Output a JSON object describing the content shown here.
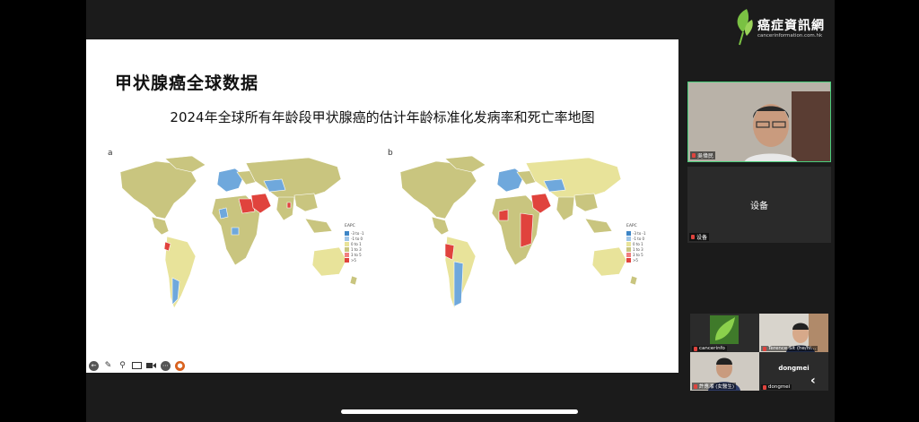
{
  "slide": {
    "title": "甲状腺癌全球数据",
    "subtitle": "2024年全球所有年龄段甲状腺癌的估计年龄标准化发病率和死亡率地图",
    "map_a_label": "a",
    "map_b_label": "b",
    "legend_title": "EAPC",
    "legend_items": [
      "-3 to -1",
      "-1 to 0",
      "0 to 1",
      "1 to 3",
      "3 to 5",
      ">5"
    ]
  },
  "logo": {
    "name": "癌症資訊網",
    "url": "cancerinformation.com.hk"
  },
  "participants": {
    "main_name": "吳偉民",
    "device_label": "设备",
    "device_name": "设备",
    "tile1_name": "cancerinfo",
    "tile2_name": "Terence Sit (he/hi…",
    "tile3_name": "許應湘 (女醫生)",
    "tile4_center": "dongmei",
    "tile4_name": "dongmei"
  },
  "colors": {
    "accent_green": "#4ccf7d",
    "map_neutral": "#c9c57f",
    "map_low": "#e8e39a",
    "map_blue": "#6fa8dc",
    "map_red": "#e0433d"
  }
}
